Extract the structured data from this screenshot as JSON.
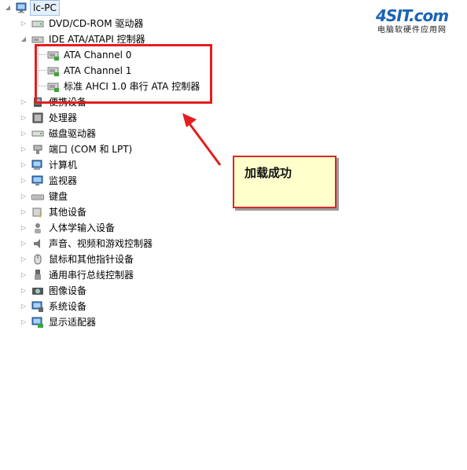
{
  "tree": {
    "root": {
      "label": "lc-PC"
    },
    "nodes": [
      {
        "label": "DVD/CD-ROM 驱动器",
        "icon": "dvd-drive-icon",
        "expander": "collapsed"
      },
      {
        "label": "IDE ATA/ATAPI 控制器",
        "icon": "ide-controller-icon",
        "expander": "expanded"
      },
      {
        "label": "ATA Channel 0",
        "icon": "ide-channel-icon",
        "child": true
      },
      {
        "label": "ATA Channel 1",
        "icon": "ide-channel-icon",
        "child": true
      },
      {
        "label": "标准 AHCI 1.0 串行 ATA 控制器",
        "icon": "ahci-controller-icon",
        "child": true
      },
      {
        "label": "便携设备",
        "icon": "portable-device-icon",
        "expander": "collapsed"
      },
      {
        "label": "处理器",
        "icon": "processor-icon",
        "expander": "collapsed"
      },
      {
        "label": "磁盘驱动器",
        "icon": "disk-drive-icon",
        "expander": "collapsed"
      },
      {
        "label": "端口 (COM 和 LPT)",
        "icon": "port-icon",
        "expander": "collapsed"
      },
      {
        "label": "计算机",
        "icon": "computer-icon",
        "expander": "collapsed"
      },
      {
        "label": "监视器",
        "icon": "monitor-icon",
        "expander": "collapsed"
      },
      {
        "label": "键盘",
        "icon": "keyboard-icon",
        "expander": "collapsed"
      },
      {
        "label": "其他设备",
        "icon": "unknown-device-icon",
        "expander": "collapsed"
      },
      {
        "label": "人体学输入设备",
        "icon": "hid-icon",
        "expander": "collapsed"
      },
      {
        "label": "声音、视频和游戏控制器",
        "icon": "speaker-icon",
        "expander": "collapsed"
      },
      {
        "label": "鼠标和其他指针设备",
        "icon": "mouse-icon",
        "expander": "collapsed"
      },
      {
        "label": "通用串行总线控制器",
        "icon": "usb-icon",
        "expander": "collapsed"
      },
      {
        "label": "图像设备",
        "icon": "camera-icon",
        "expander": "collapsed"
      },
      {
        "label": "系统设备",
        "icon": "system-device-icon",
        "expander": "collapsed"
      },
      {
        "label": "显示适配器",
        "icon": "display-adapter-icon",
        "expander": "collapsed"
      }
    ]
  },
  "annotation": {
    "note_text": "加载成功",
    "box_color": "#e41e1e",
    "note_bg": "#ffffcc"
  },
  "watermark": {
    "brand": "4SIT.com",
    "tagline": "电脑软硬件应用网",
    "color": "#1a63b4"
  }
}
